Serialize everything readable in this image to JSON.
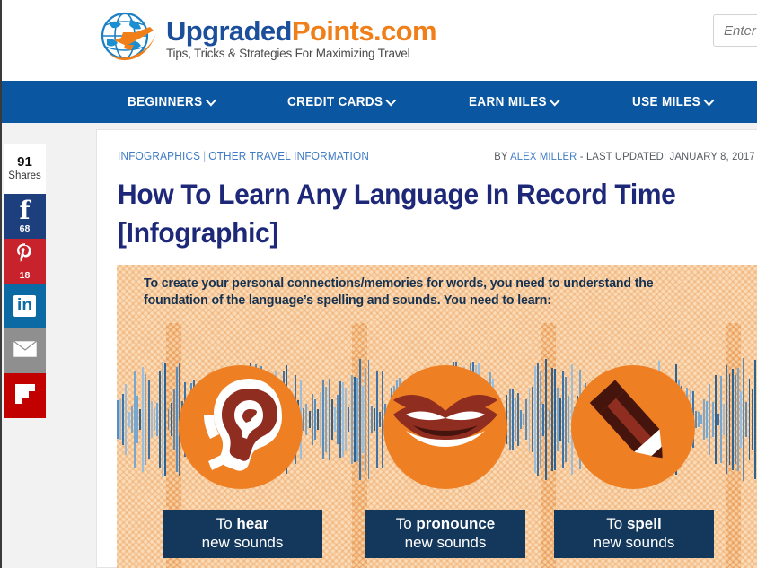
{
  "browser": {
    "page_background": "#f2f2f2"
  },
  "header": {
    "logo": {
      "name_part1": "Upgraded",
      "name_part2": "Points",
      "name_part3": ".com",
      "tagline": "Tips, Tricks & Strategies For Maximizing Travel",
      "icon": "globe-airplane-icon"
    },
    "search": {
      "placeholder": "Enter Your Search",
      "value": ""
    }
  },
  "nav": {
    "background": "#0a56a0",
    "items": [
      {
        "label": "BEGINNERS",
        "has_dropdown": true
      },
      {
        "label": "CREDIT CARDS",
        "has_dropdown": true
      },
      {
        "label": "EARN MILES",
        "has_dropdown": true
      },
      {
        "label": "USE MILES",
        "has_dropdown": true
      }
    ]
  },
  "share_rail": {
    "total_count": "91",
    "total_label": "Shares",
    "buttons": [
      {
        "network": "facebook",
        "icon": "facebook-icon",
        "count": "68",
        "color": "#1e3f7d",
        "glyph": "f"
      },
      {
        "network": "pinterest",
        "icon": "pinterest-icon",
        "count": "18",
        "color": "#c8232c",
        "glyph": "P"
      },
      {
        "network": "linkedin",
        "icon": "linkedin-icon",
        "count": "",
        "color": "#0b69a3",
        "glyph": "in"
      },
      {
        "network": "email",
        "icon": "email-icon",
        "count": "",
        "color": "#8f8f8f",
        "glyph": ""
      },
      {
        "network": "flipboard",
        "icon": "flipboard-icon",
        "count": "",
        "color": "#c20000",
        "glyph": ""
      }
    ]
  },
  "article": {
    "categories": [
      {
        "label": "INFOGRAPHICS"
      },
      {
        "label": "OTHER TRAVEL INFORMATION"
      }
    ],
    "category_separator": "|",
    "byline_prefix": "BY ",
    "byline_author": "ALEX MILLER",
    "byline_suffix": " - LAST UPDATED: JANUARY 8, 2017",
    "title": "How To Learn Any Language In Record Time [Infographic]",
    "title_color": "#1e2878"
  },
  "infographic": {
    "background_color": "#fbdcb9",
    "intro_text": "To create your personal connections/memories for words, you need to understand the foundation of the language’s spelling and sounds. You need to learn:",
    "intro_color": "#16314f",
    "accent_color": "#ee7f23",
    "label_box_color": "#14385c",
    "panels": [
      {
        "icon": "ear-icon",
        "label_line1_prefix": "To ",
        "label_line1_bold": "hear",
        "label_line2": "new sounds"
      },
      {
        "icon": "lips-icon",
        "label_line1_prefix": "To ",
        "label_line1_bold": "pronounce",
        "label_line2": "new sounds"
      },
      {
        "icon": "pencil-icon",
        "label_line1_prefix": "To ",
        "label_line1_bold": "spell",
        "label_line2": "new sounds"
      }
    ]
  }
}
